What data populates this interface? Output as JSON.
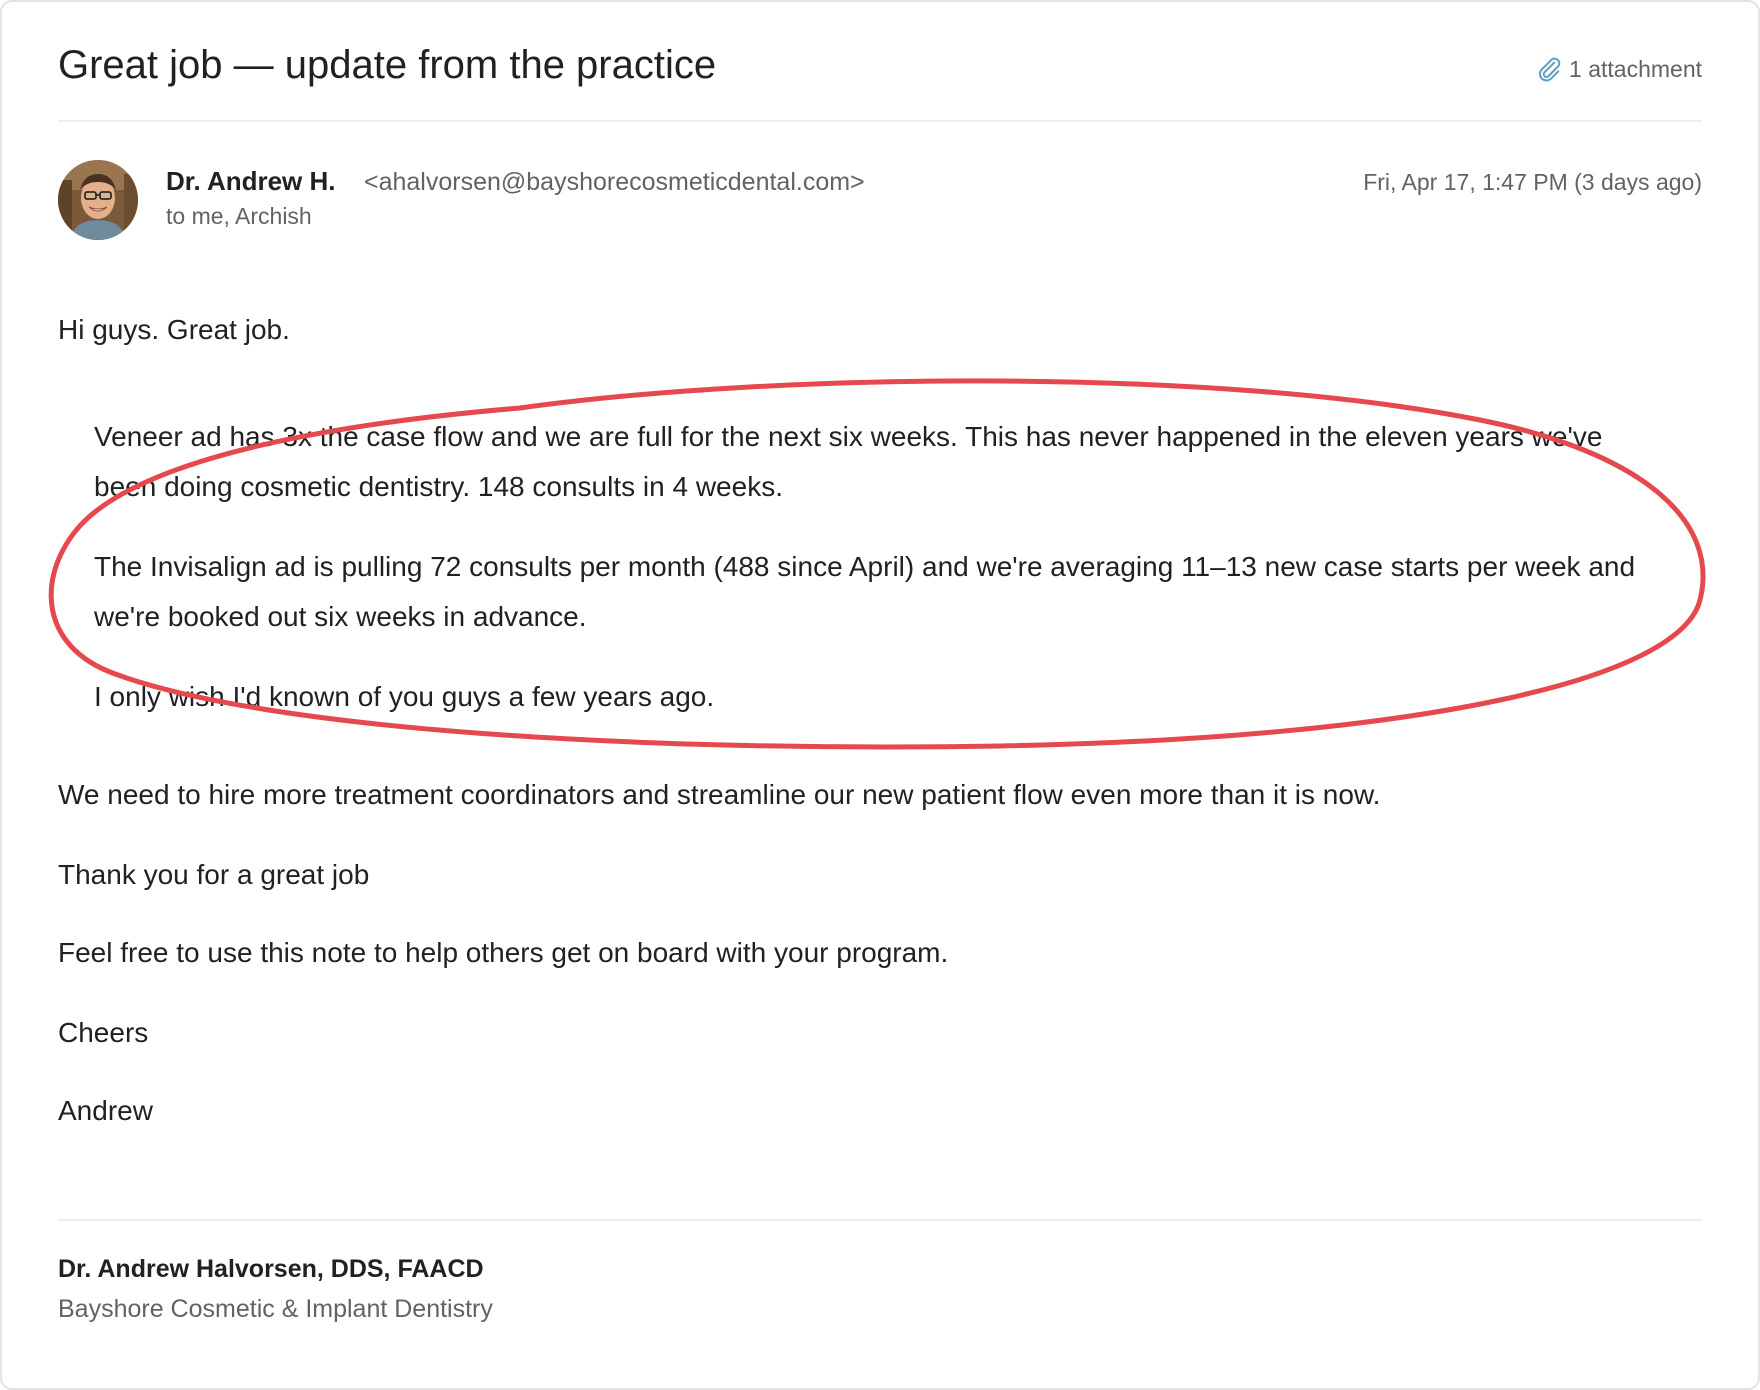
{
  "email": {
    "subject": "Great job — update from the practice",
    "attachment_label": "1 attachment",
    "attachment_icon": "paperclip-icon",
    "sender": {
      "name": "Dr. Andrew H.",
      "email": "<ahalvorsen@bayshorecosmeticdental.com>",
      "recipients": "to me, Archish",
      "date": "Fri, Apr 17, 1:47 PM (3 days ago)"
    },
    "body": {
      "greeting": "Hi guys. Great job.",
      "quote_1": "Veneer ad has 3x the case flow and we are full for the next six weeks. This has never happened in the eleven years we've been doing cosmetic dentistry. 148 consults in 4 weeks.",
      "quote_2": "The Invisalign ad is pulling 72 consults per month (488 since April) and we're averaging 11–13 new case starts per week and we're booked out six weeks in advance.",
      "quote_3": "I only wish I'd known of you guys a few years ago.",
      "para_1": "We need to hire more treatment coordinators and streamline our new patient flow even more than it is now.",
      "para_2": "Thank you for a great job",
      "para_3": "Feel free to use this note to help others get on board with your program.",
      "closing": "Cheers",
      "signoff": "Andrew"
    },
    "signature": {
      "name": "Dr. Andrew Halvorsen, DDS, FAACD",
      "company": "Bayshore Cosmetic & Implant Dentistry"
    }
  },
  "colors": {
    "annotation_circle": "#e5484d",
    "muted_text": "#5f6368",
    "body_text": "#202124"
  }
}
